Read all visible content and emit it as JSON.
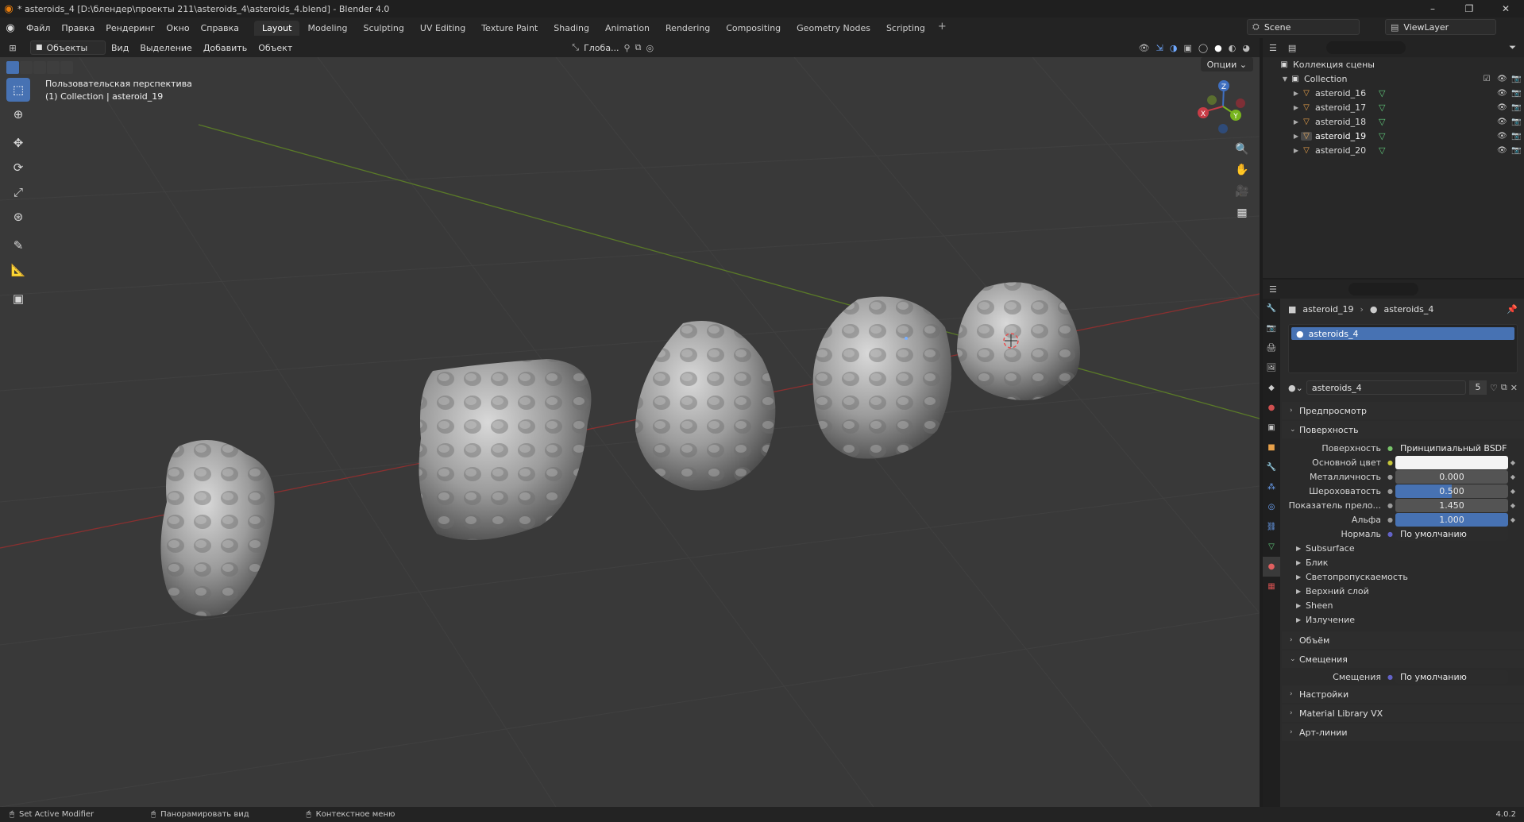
{
  "window": {
    "title": "* asteroids_4 [D:\\блендер\\проекты 211\\asteroids_4\\asteroids_4.blend] - Blender 4.0",
    "controls": [
      "–",
      "❐",
      "✕"
    ]
  },
  "menu": {
    "items": [
      "Файл",
      "Правка",
      "Рендеринг",
      "Окно",
      "Справка"
    ],
    "workspaces": [
      "Layout",
      "Modeling",
      "Sculpting",
      "UV Editing",
      "Texture Paint",
      "Shading",
      "Animation",
      "Rendering",
      "Compositing",
      "Geometry Nodes",
      "Scripting"
    ],
    "active_workspace": "Layout",
    "add_tab": "+",
    "scene": "Scene",
    "view_layer": "ViewLayer"
  },
  "viewport_header": {
    "mode": "Объекты",
    "items": [
      "Вид",
      "Выделение",
      "Добавить",
      "Объект"
    ],
    "orientation": "Глоба...",
    "options": "Опции"
  },
  "viewport": {
    "view_name": "Пользовательская перспектива",
    "context": "(1) Collection | asteroid_19",
    "gizmo": {
      "x": "X",
      "y": "Y",
      "z": "Z"
    }
  },
  "outliner": {
    "root": "Коллекция сцены",
    "collection": "Collection",
    "objects": [
      "asteroid_16",
      "asteroid_17",
      "asteroid_18",
      "asteroid_19",
      "asteroid_20"
    ],
    "selected": "asteroid_19"
  },
  "properties": {
    "breadcrumb": {
      "object": "asteroid_19",
      "material": "asteroids_4"
    },
    "slot": "asteroids_4",
    "material_name": "asteroids_4",
    "user_count": "5",
    "panels": {
      "preview": "Предпросмотр",
      "surface": "Поверхность",
      "volume": "Объём",
      "displacement": "Смещения",
      "settings": "Настройки",
      "material_library": "Material Library VX",
      "lineart": "Арт-линии"
    },
    "surface_rows": [
      {
        "label": "Поверхность",
        "value": "Принципиальный BSDF",
        "kind": "link"
      },
      {
        "label": "Основной цвет",
        "value": "",
        "kind": "color"
      },
      {
        "label": "Металличность",
        "value": "0.000",
        "kind": "num",
        "fill": 0.0
      },
      {
        "label": "Шероховатость",
        "value": "0.500",
        "kind": "num",
        "fill": 0.5
      },
      {
        "label": "Показатель прело...",
        "value": "1.450",
        "kind": "num",
        "fill": 0.0
      },
      {
        "label": "Альфа",
        "value": "1.000",
        "kind": "num",
        "fill": 1.0
      },
      {
        "label": "Нормаль",
        "value": "По умолчанию",
        "kind": "link"
      }
    ],
    "subpanels": [
      "Subsurface",
      "Блик",
      "Светопропускаемость",
      "Верхний слой",
      "Sheen",
      "Излучение"
    ],
    "displacement_row": {
      "label": "Смещения",
      "value": "По умолчанию"
    }
  },
  "statusbar": {
    "items": [
      "Set Active Modifier",
      "Панорамировать вид",
      "Контекстное меню"
    ],
    "version": "4.0.2"
  },
  "colors": {
    "accent": "#4772b3",
    "x_axis": "#a83a3a",
    "y_axis": "#6b8e23",
    "blender_orange": "#e87d0d"
  }
}
